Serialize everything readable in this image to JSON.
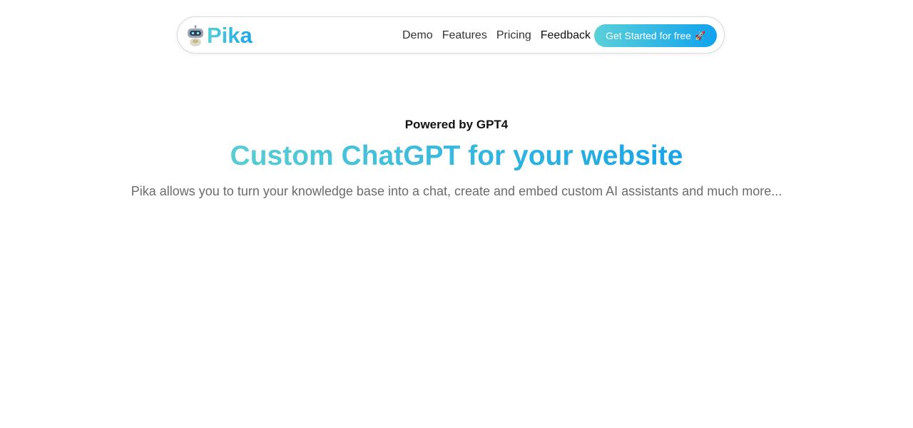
{
  "brand": {
    "name": "Pika",
    "logo_icon": "robot-icon"
  },
  "nav": {
    "links": [
      {
        "label": "Demo"
      },
      {
        "label": "Features"
      },
      {
        "label": "Pricing"
      },
      {
        "label": "Feedback"
      }
    ],
    "cta": {
      "label": "Get Started for free",
      "icon": "rocket-icon"
    }
  },
  "hero": {
    "eyebrow": "Powered by GPT4",
    "headline": "Custom ChatGPT for your website",
    "subheadline": "Pika allows you to turn your knowledge base into a chat, create and embed custom AI assistants and much more..."
  },
  "colors": {
    "gradient_start": "#5ad0d8",
    "gradient_end": "#10a2ee",
    "text_dark": "#111111",
    "text_muted": "#6b6b6b"
  }
}
